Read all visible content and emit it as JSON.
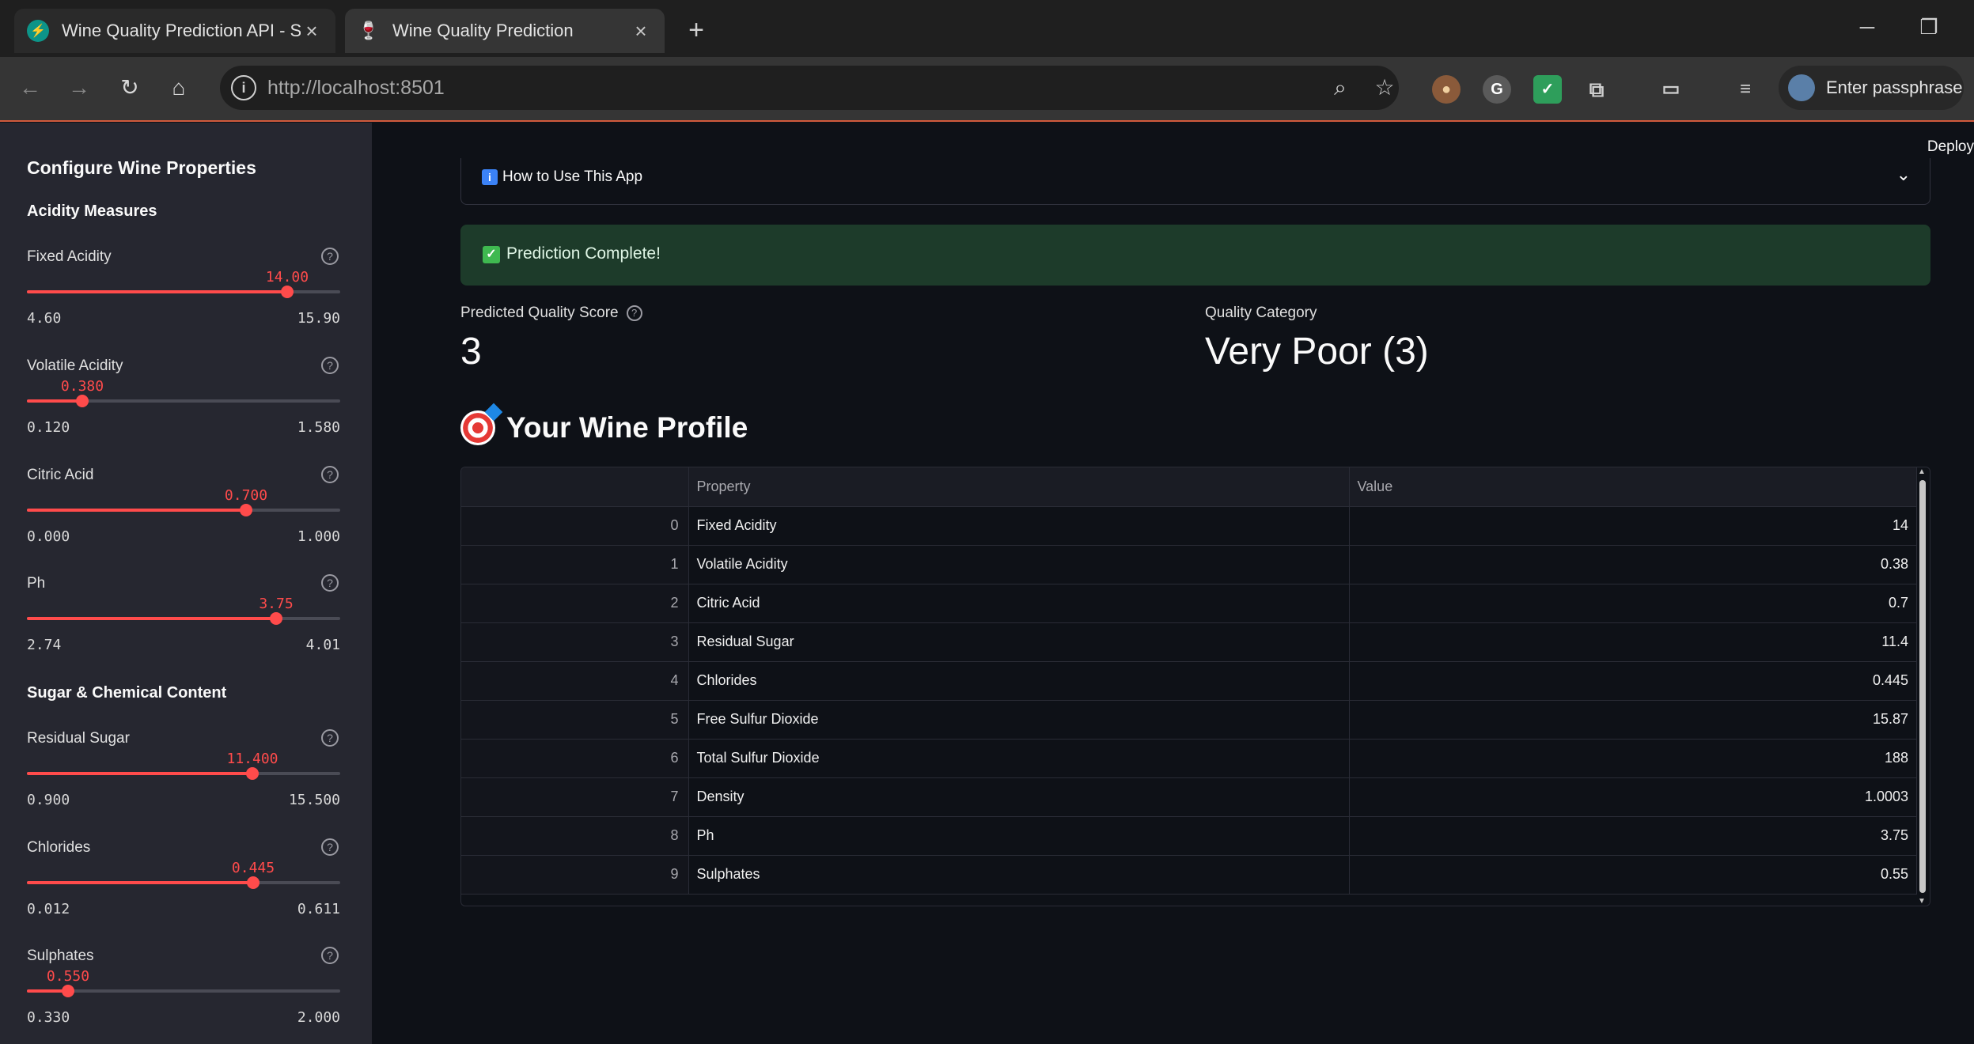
{
  "browser": {
    "tabs": [
      {
        "title": "Wine Quality Prediction API - Sw",
        "active": false
      },
      {
        "title": "Wine Quality Prediction",
        "active": true
      }
    ],
    "new_tab": "+",
    "url_scheme_host": "http://localhost",
    "url_port": ":8501",
    "profile_label": "Enter passphrase"
  },
  "sidebar": {
    "title": "Configure Wine Properties",
    "sections": [
      {
        "title": "Acidity Measures"
      },
      {
        "title": "Sugar & Chemical Content"
      }
    ],
    "sliders": [
      {
        "label": "Fixed Acidity",
        "value": "14.00",
        "min": "4.60",
        "max": "15.90",
        "fraction": 0.832
      },
      {
        "label": "Volatile Acidity",
        "value": "0.380",
        "min": "0.120",
        "max": "1.580",
        "fraction": 0.178
      },
      {
        "label": "Citric Acid",
        "value": "0.700",
        "min": "0.000",
        "max": "1.000",
        "fraction": 0.7
      },
      {
        "label": "Ph",
        "value": "3.75",
        "min": "2.74",
        "max": "4.01",
        "fraction": 0.795
      },
      {
        "label": "Residual Sugar",
        "value": "11.400",
        "min": "0.900",
        "max": "15.500",
        "fraction": 0.719
      },
      {
        "label": "Chlorides",
        "value": "0.445",
        "min": "0.012",
        "max": "0.611",
        "fraction": 0.723
      },
      {
        "label": "Sulphates",
        "value": "0.550",
        "min": "0.330",
        "max": "2.000",
        "fraction": 0.132
      }
    ]
  },
  "main": {
    "deploy_label": "Deploy",
    "expander_label": "How to Use This App",
    "success_message": "Prediction Complete!",
    "metrics": [
      {
        "label": "Predicted Quality Score",
        "value": "3"
      },
      {
        "label": "Quality Category",
        "value": "Very Poor (3)"
      }
    ],
    "profile_heading": "Your Wine Profile",
    "table": {
      "columns": [
        "",
        "Property",
        "Value"
      ],
      "rows": [
        {
          "index": "0",
          "property": "Fixed Acidity",
          "value": "14"
        },
        {
          "index": "1",
          "property": "Volatile Acidity",
          "value": "0.38"
        },
        {
          "index": "2",
          "property": "Citric Acid",
          "value": "0.7"
        },
        {
          "index": "3",
          "property": "Residual Sugar",
          "value": "11.4"
        },
        {
          "index": "4",
          "property": "Chlorides",
          "value": "0.445"
        },
        {
          "index": "5",
          "property": "Free Sulfur Dioxide",
          "value": "15.87"
        },
        {
          "index": "6",
          "property": "Total Sulfur Dioxide",
          "value": "188"
        },
        {
          "index": "7",
          "property": "Density",
          "value": "1.0003"
        },
        {
          "index": "8",
          "property": "Ph",
          "value": "3.75"
        },
        {
          "index": "9",
          "property": "Sulphates",
          "value": "0.55"
        }
      ]
    }
  },
  "colors": {
    "accent": "#ff4b4b",
    "sidebar_bg": "#262730",
    "main_bg": "#0e1117",
    "success_bg": "#1d3b2a"
  }
}
